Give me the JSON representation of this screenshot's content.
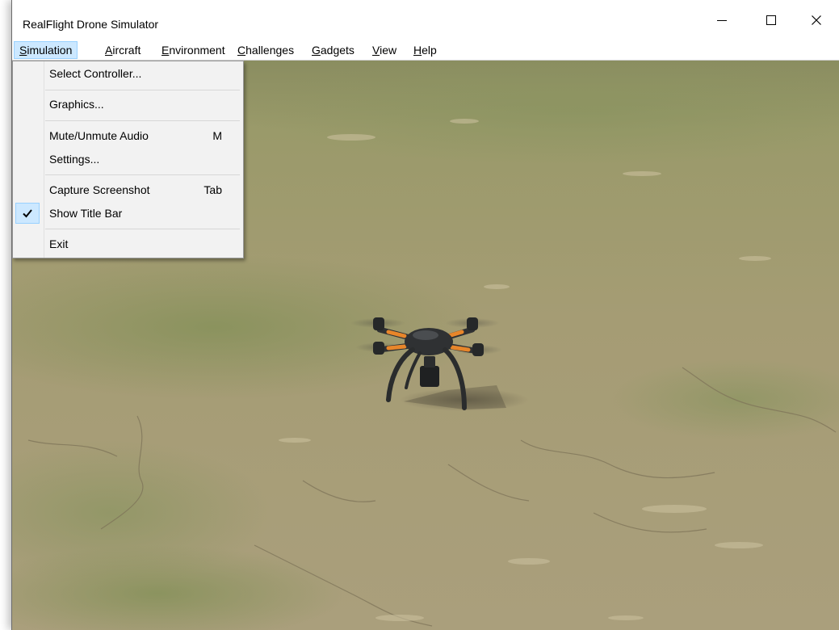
{
  "window": {
    "title": "RealFlight Drone Simulator"
  },
  "title_buttons": {
    "minimize": "minimize-icon",
    "maximize": "maximize-icon",
    "close": "close-icon"
  },
  "menubar": {
    "items": [
      {
        "access": "S",
        "rest": "imulation"
      },
      {
        "access": "A",
        "rest": "ircraft"
      },
      {
        "access": "E",
        "rest": "nvironment"
      },
      {
        "access": "C",
        "rest": "hallenges"
      },
      {
        "access": "G",
        "rest": "adgets"
      },
      {
        "access": "V",
        "rest": "iew"
      },
      {
        "access": "H",
        "rest": "elp"
      }
    ],
    "active_index": 0
  },
  "simulation_menu": {
    "select_controller": "Select Controller...",
    "graphics": "Graphics...",
    "mute_audio": "Mute/Unmute Audio",
    "mute_audio_shortcut": "M",
    "settings": "Settings...",
    "capture_screenshot": "Capture Screenshot",
    "capture_screenshot_shortcut": "Tab",
    "show_title_bar": "Show Title Bar",
    "show_title_bar_checked": true,
    "exit": "Exit"
  },
  "colors": {
    "menu_highlight": "#cce8ff",
    "menu_highlight_border": "#99d1ff",
    "drone_accent": "#e8862a",
    "drone_body": "#2f3133",
    "ground": "#a39a72"
  },
  "scene": {
    "subject": "quadcopter-drone"
  }
}
